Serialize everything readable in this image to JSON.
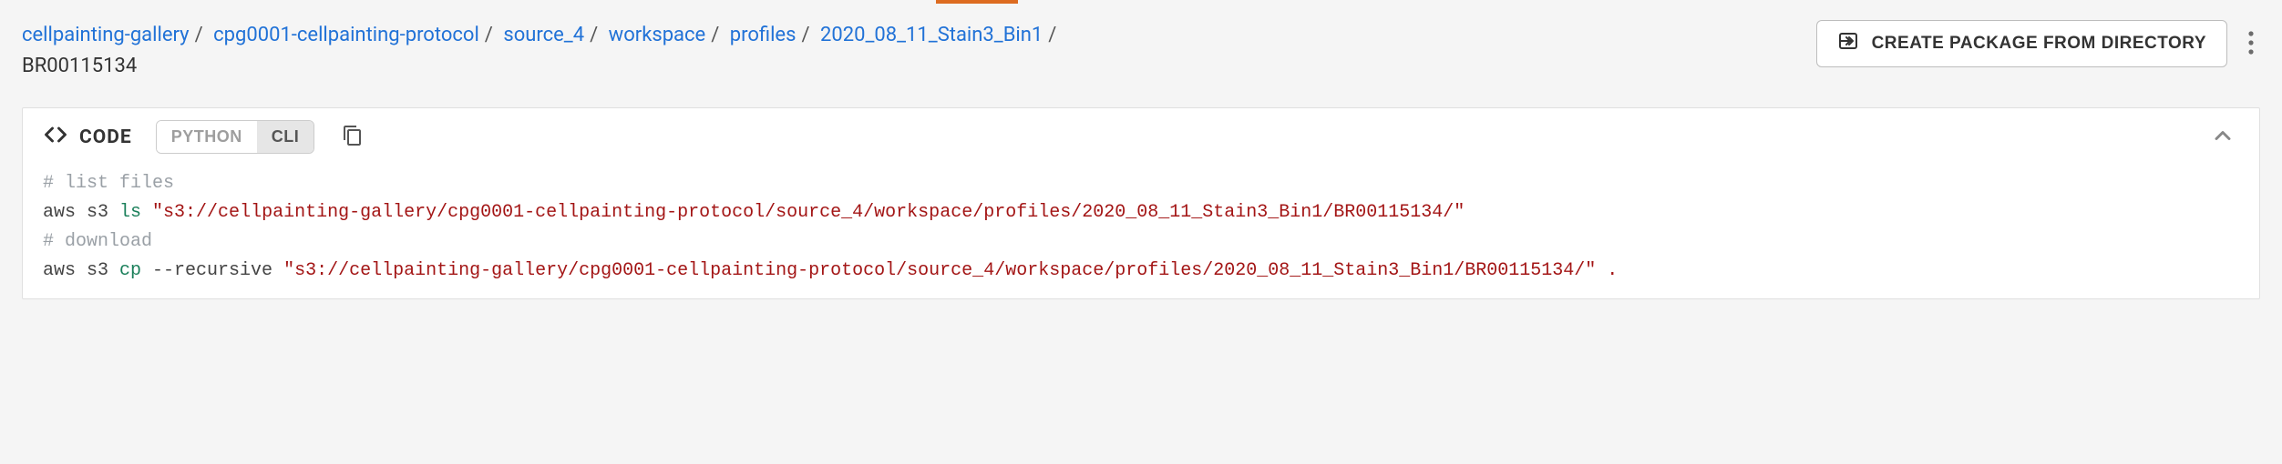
{
  "breadcrumb": {
    "items": [
      {
        "label": "cellpainting-gallery"
      },
      {
        "label": "cpg0001-cellpainting-protocol"
      },
      {
        "label": "source_4"
      },
      {
        "label": "workspace"
      },
      {
        "label": "profiles"
      },
      {
        "label": "2020_08_11_Stain3_Bin1"
      }
    ],
    "current": "BR00115134"
  },
  "actions": {
    "create_package_label": "CREATE PACKAGE FROM DIRECTORY"
  },
  "code_panel": {
    "title": "CODE",
    "tabs": {
      "python": "PYTHON",
      "cli": "CLI"
    },
    "active_tab": "cli",
    "lines": [
      {
        "type": "comment",
        "text": "# list files"
      },
      {
        "type": "cmd",
        "prefix": "aws s3 ",
        "cmd": "ls",
        "mid": " ",
        "str": "\"s3://cellpainting-gallery/cpg0001-cellpainting-protocol/source_4/workspace/profiles/2020_08_11_Stain3_Bin1/BR00115134/\""
      },
      {
        "type": "comment",
        "text": "# download"
      },
      {
        "type": "cmd",
        "prefix": "aws s3 ",
        "cmd": "cp",
        "mid": " --recursive ",
        "str": "\"s3://cellpainting-gallery/cpg0001-cellpainting-protocol/source_4/workspace/profiles/2020_08_11_Stain3_Bin1/BR00115134/\" ."
      }
    ]
  }
}
